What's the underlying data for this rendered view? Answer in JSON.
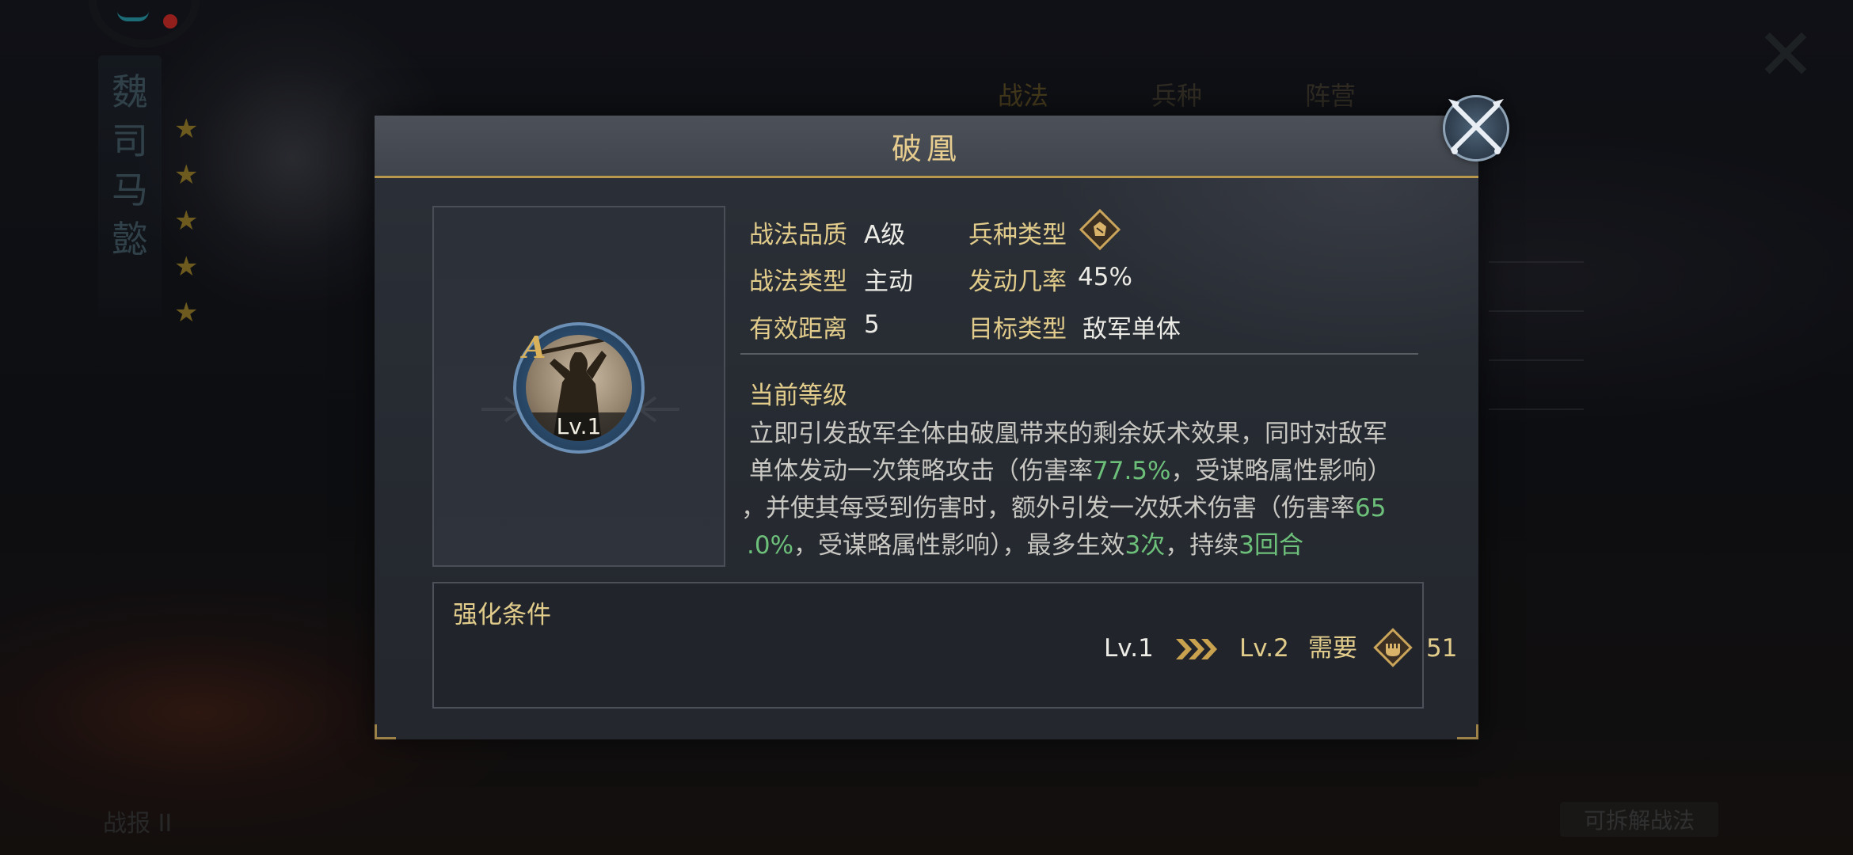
{
  "dialog": {
    "title": "破凰",
    "close_icon": "crossed-swords-close-icon"
  },
  "skill": {
    "grade": "A",
    "level": "Lv.1",
    "portrait_icon": "warrior-silhouette-icon"
  },
  "attributes": {
    "quality_label": "战法品质",
    "quality_value": "A级",
    "unit_type_label": "兵种类型",
    "unit_type_icon": "troop-type-diamond-icon",
    "tactic_type_label": "战法类型",
    "tactic_type_value": "主动",
    "trigger_rate_label": "发动几率",
    "trigger_rate_value": "45%",
    "range_label": "有效距离",
    "range_value": "5",
    "target_label": "目标类型",
    "target_value": "敌军单体"
  },
  "current_level": {
    "heading": "当前等级",
    "line1": "立即引发敌军全体由破凰带来的剩余妖术效果，同时对敌军",
    "line2_a": "单体发动一次策略攻击（伤害率",
    "line2_hl": "77.5%",
    "line2_b": "，受谋略属性影响）",
    "line3_a": "，并使其每受到伤害时，额外引发一次妖术伤害（伤害率",
    "line3_hl": "65",
    "line4_hl": ".0%",
    "line4_a": "，受谋略属性影响），最多生效",
    "line4_hl2": "3次",
    "line4_b": "，持续",
    "line4_hl3": "3回合"
  },
  "upgrade": {
    "heading": "强化条件",
    "from_level": "Lv.1",
    "arrows_icon": "triple-chevron-right-icon",
    "to_level": "Lv.2",
    "need_label": "需要",
    "cost_icon": "fist-token-icon",
    "cost_value": "51"
  },
  "background": {
    "name_chars": [
      "魏",
      "司",
      "马",
      "懿"
    ],
    "tabs": [
      "战法",
      "兵种",
      "阵营"
    ],
    "bottom_left": "战报 II",
    "bottom_right": "可拆解战法"
  },
  "colors": {
    "title_gold": "#e6cc8f",
    "label_gold": "#e2cc8b",
    "highlight_green": "#6dc07a",
    "body_text": "#c8c7c2"
  }
}
